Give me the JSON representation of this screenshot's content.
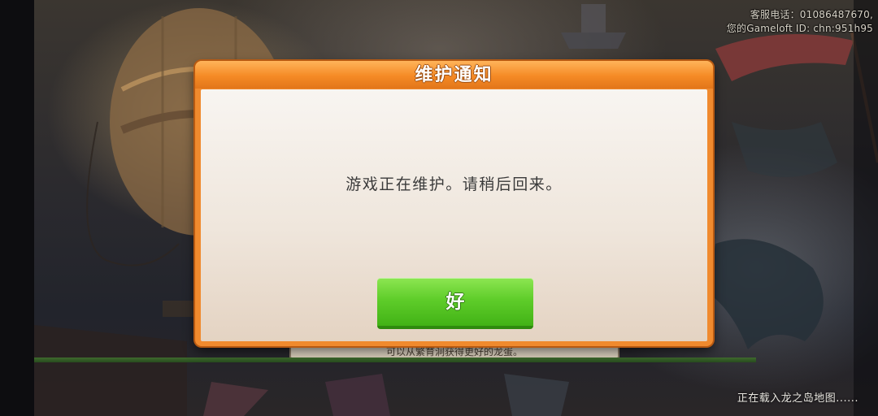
{
  "hud": {
    "phone": "客服电话：01086487670,",
    "gameloft_id": "您的Gameloft ID: chn:951h95"
  },
  "dialog": {
    "title": "维护通知",
    "message": "游戏正在维护。请稍后回来。",
    "ok_label": "好"
  },
  "tip": {
    "text": "可以从繁育洞获得更好的龙蛋。"
  },
  "loading": {
    "text": "正在载入龙之岛地图......",
    "progress": 1.0
  },
  "colors": {
    "header_orange": "#f58a25",
    "button_green": "#5fcd2a",
    "progress_green": "#3f6a2d"
  },
  "icons": [
    "hot-air-balloon-art",
    "airship-art",
    "banner-flag-art",
    "dragon-art"
  ]
}
